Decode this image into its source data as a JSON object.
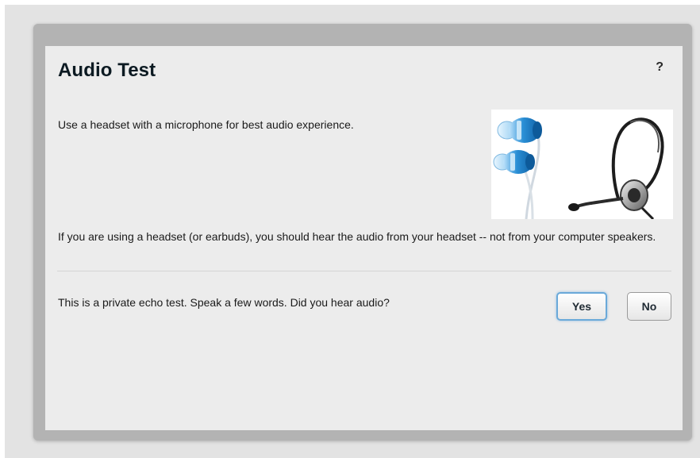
{
  "dialog": {
    "title": "Audio Test",
    "help_label": "?",
    "intro": "Use a headset with a microphone for best audio experience.",
    "info": "If you are using a headset (or earbuds), you should hear the audio from your headset -- not from your computer speakers.",
    "echo_prompt": "This is a private echo test.  Speak a few words.  Did you hear audio?",
    "yes_label": "Yes",
    "no_label": "No"
  },
  "image": {
    "icon": "headset-and-earbuds-image"
  },
  "colors": {
    "accent": "#6aa9d9",
    "earbud_blue": "#2a8fd6",
    "title": "#0c1a22",
    "panel": "#ececec",
    "frame": "#b3b3b3"
  }
}
